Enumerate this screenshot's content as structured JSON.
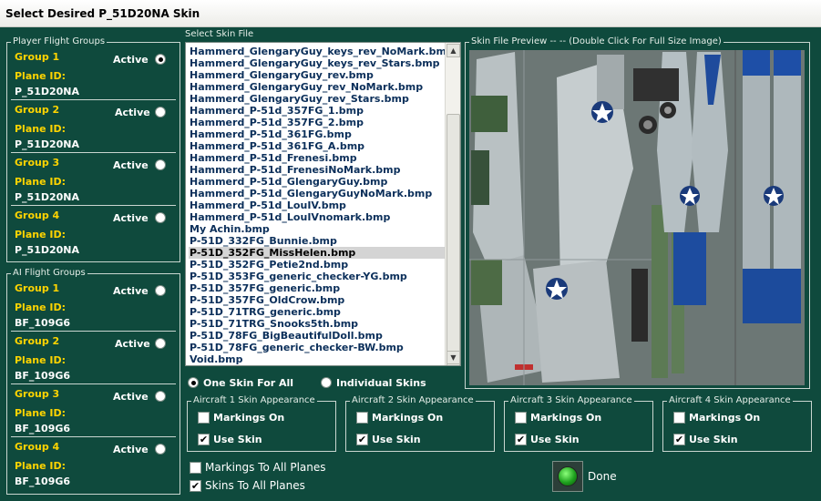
{
  "window": {
    "title": "Select Desired P_51D20NA Skin"
  },
  "player_groups": {
    "legend": "Player Flight Groups",
    "groups": [
      {
        "name": "Group 1",
        "active": "Active",
        "plane_id_label": "Plane ID:",
        "plane_id": "P_51D20NA",
        "selected": true
      },
      {
        "name": "Group 2",
        "active": "Active",
        "plane_id_label": "Plane ID:",
        "plane_id": "P_51D20NA",
        "selected": false
      },
      {
        "name": "Group 3",
        "active": "Active",
        "plane_id_label": "Plane ID:",
        "plane_id": "P_51D20NA",
        "selected": false
      },
      {
        "name": "Group 4",
        "active": "Active",
        "plane_id_label": "Plane ID:",
        "plane_id": "P_51D20NA",
        "selected": false
      }
    ]
  },
  "ai_groups": {
    "legend": "AI Flight Groups",
    "groups": [
      {
        "name": "Group 1",
        "active": "Active",
        "plane_id_label": "Plane ID:",
        "plane_id": "BF_109G6",
        "selected": false
      },
      {
        "name": "Group 2",
        "active": "Active",
        "plane_id_label": "Plane ID:",
        "plane_id": "BF_109G6",
        "selected": false
      },
      {
        "name": "Group 3",
        "active": "Active",
        "plane_id_label": "Plane ID:",
        "plane_id": "BF_109G6",
        "selected": false
      },
      {
        "name": "Group 4",
        "active": "Active",
        "plane_id_label": "Plane ID:",
        "plane_id": "BF_109G6",
        "selected": false
      }
    ]
  },
  "skin_file": {
    "label": "Select Skin File",
    "selected": "P-51D_352FG_MissHelen.bmp",
    "files": [
      "Hammerd_GlengaryGuy_keys_rev_NoMark.bmp",
      "Hammerd_GlengaryGuy_keys_rev_Stars.bmp",
      "Hammerd_GlengaryGuy_rev.bmp",
      "Hammerd_GlengaryGuy_rev_NoMark.bmp",
      "Hammerd_GlengaryGuy_rev_Stars.bmp",
      "Hammerd_P-51d_357FG_1.bmp",
      "Hammerd_P-51d_357FG_2.bmp",
      "Hammerd_P-51d_361FG.bmp",
      "Hammerd_P-51d_361FG_A.bmp",
      "Hammerd_P-51d_Frenesi.bmp",
      "Hammerd_P-51d_FrenesiNoMark.bmp",
      "Hammerd_P-51d_GlengaryGuy.bmp",
      "Hammerd_P-51d_GlengaryGuyNoMark.bmp",
      "Hammerd_P-51d_LouIV.bmp",
      "Hammerd_P-51d_LouIVnomark.bmp",
      "My Achin.bmp",
      "P-51D_332FG_Bunnie.bmp",
      "P-51D_352FG_MissHelen.bmp",
      "P-51D_352FG_Petie2nd.bmp",
      "P-51D_353FG_generic_checker-YG.bmp",
      "P-51D_357FG_generic.bmp",
      "P-51D_357FG_OldCrow.bmp",
      "P-51D_71TRG_generic.bmp",
      "P-51D_71TRG_Snooks5th.bmp",
      "P-51D_78FG_BigBeautifulDoll.bmp",
      "P-51D_78FG_generic_checker-BW.bmp",
      "Void.bmp"
    ]
  },
  "preview": {
    "legend": "Skin File Preview  -- --  (Double Click For Full Size Image)"
  },
  "skin_mode": {
    "one_skin": "One Skin For All",
    "individual": "Individual Skins",
    "selected": "one_skin"
  },
  "aircraft_appearance": [
    {
      "legend": "Aircraft 1 Skin Appearance",
      "markings": "Markings On",
      "markings_checked": false,
      "use_skin": "Use Skin",
      "use_skin_checked": true
    },
    {
      "legend": "Aircraft 2 Skin Appearance",
      "markings": "Markings On",
      "markings_checked": false,
      "use_skin": "Use Skin",
      "use_skin_checked": true
    },
    {
      "legend": "Aircraft 3 Skin Appearance",
      "markings": "Markings On",
      "markings_checked": false,
      "use_skin": "Use Skin",
      "use_skin_checked": true
    },
    {
      "legend": "Aircraft 4 Skin Appearance",
      "markings": "Markings On",
      "markings_checked": false,
      "use_skin": "Use Skin",
      "use_skin_checked": true
    }
  ],
  "bottom": {
    "markings_all": "Markings To All Planes",
    "markings_all_checked": false,
    "skins_all": "Skins To All Planes",
    "skins_all_checked": true,
    "done": "Done"
  },
  "check_glyph": "✔"
}
